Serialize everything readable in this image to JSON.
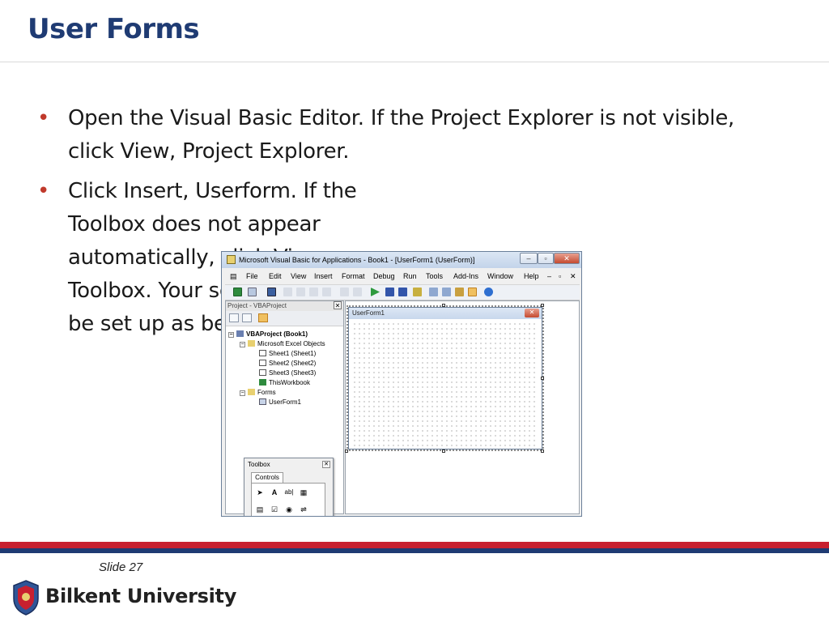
{
  "slide": {
    "title": "User Forms",
    "bullets": [
      "Open the Visual Basic Editor. If the Project Explorer is not visible, click View, Project Explorer.",
      "Click Insert, Userform. If the Toolbox does not appear automatically, click View, Toolbox. Your screen should be set up as below."
    ],
    "slide_number": "Slide 27",
    "university": "Bilkent University"
  },
  "colors": {
    "title": "#1f3b73",
    "bullet": "#c0392b",
    "bar_red": "#c8202f",
    "bar_blue": "#1f3b73"
  },
  "vbe": {
    "title": "Microsoft Visual Basic for Applications - Book1 - [UserForm1 (UserForm)]",
    "menu": [
      "File",
      "Edit",
      "View",
      "Insert",
      "Format",
      "Debug",
      "Run",
      "Tools",
      "Add-Ins",
      "Window",
      "Help"
    ],
    "project_panel_title": "Project - VBAProject",
    "tree": {
      "root": "VBAProject (Book1)",
      "excel_objects": "Microsoft Excel Objects",
      "sheet1": "Sheet1 (Sheet1)",
      "sheet2": "Sheet2 (Sheet2)",
      "sheet3": "Sheet3 (Sheet3)",
      "workbook": "ThisWorkbook",
      "forms": "Forms",
      "userform": "UserForm1"
    },
    "userform_title": "UserForm1",
    "toolbox": {
      "title": "Toolbox",
      "tab": "Controls",
      "controls": [
        "pointer-icon",
        "label-icon",
        "textbox-icon",
        "combobox-icon",
        "listbox-icon",
        "checkbox-icon",
        "optionbutton-icon",
        "togglebutton-icon",
        "frame-icon",
        "commandbutton-icon",
        "tabstrip-icon",
        "multipage-icon",
        "scrollbar-icon",
        "image-icon",
        "spinbutton-icon",
        "refedit-icon"
      ]
    }
  }
}
